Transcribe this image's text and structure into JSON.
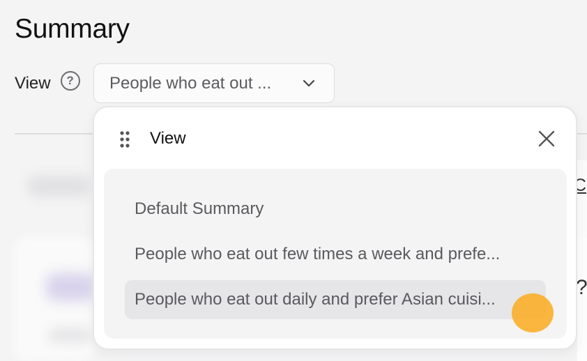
{
  "page": {
    "title": "Summary"
  },
  "view_control": {
    "label": "View",
    "help_icon": "question-circle-icon",
    "selected_value": "People who eat out ...",
    "dropdown_icon": "chevron-down-icon"
  },
  "background": {
    "right_edge_link": "C",
    "right_edge_text": "?"
  },
  "popover": {
    "title": "View",
    "drag_icon": "drag-handle-icon",
    "close_icon": "close-icon",
    "options": [
      {
        "label": "Default Summary",
        "selected": false
      },
      {
        "label": "People who eat out few times a week and prefe...",
        "selected": false
      },
      {
        "label": "People who eat out daily and prefer Asian cuisi...",
        "selected": true
      }
    ]
  },
  "colors": {
    "background": "#f4f4f5",
    "popover": "#ffffff",
    "selected_option": "#e6e6e8",
    "cursor_highlight": "#faaa1e"
  }
}
